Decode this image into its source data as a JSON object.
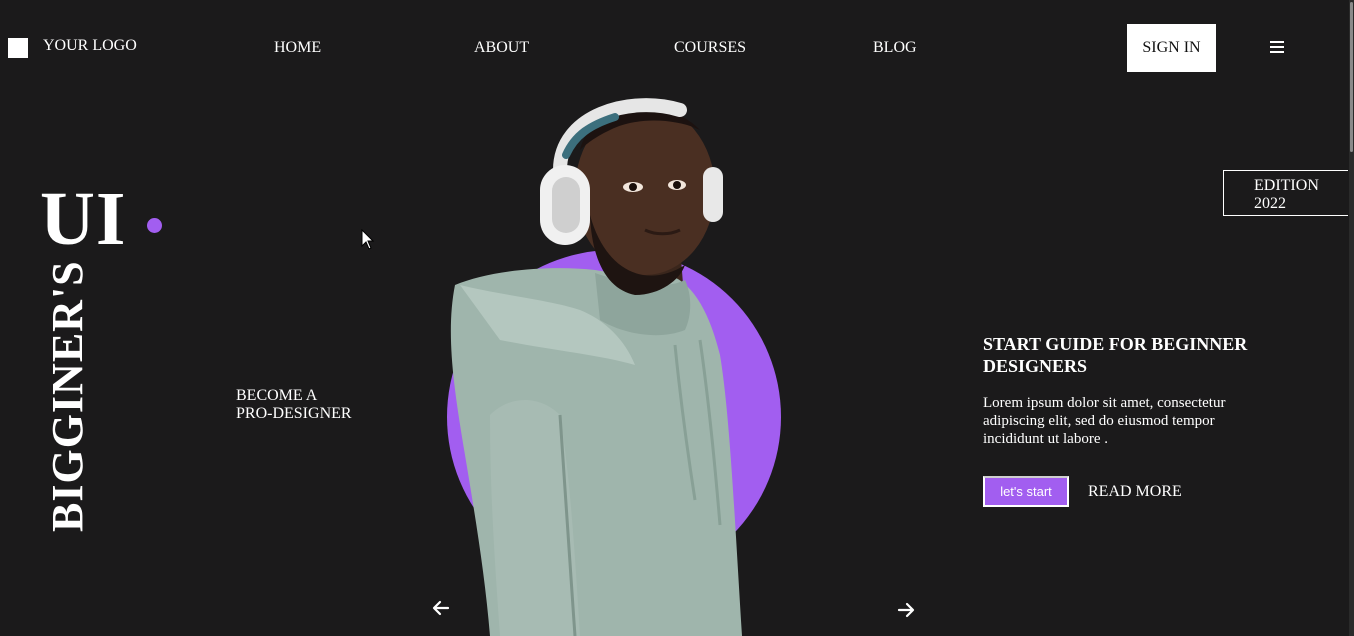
{
  "header": {
    "logo_text": "YOUR LOGO",
    "nav": [
      "HOME",
      "ABOUT",
      "COURSES",
      "BLOG"
    ],
    "signin_label": "SIGN IN",
    "menu_icon": "hamburger-icon"
  },
  "hero": {
    "big_title": "UI",
    "vertical_word": "BIGGINER'S",
    "tagline_line1": "BECOME A",
    "tagline_line2": "PRO-DESIGNER",
    "edition_line1": "EDITION",
    "edition_line2": "2022",
    "prev_icon": "arrow-left-icon",
    "next_icon": "arrow-right-icon"
  },
  "content": {
    "title_line1": "START GUIDE FOR BEGINNER",
    "title_line2": "DESIGNERS",
    "description": "Lorem ipsum dolor sit amet, consectetur adipiscing elit, sed do eiusmod tempor incididunt ut labore .",
    "primary_button": "let's start",
    "secondary_link": "READ MORE"
  },
  "colors": {
    "background": "#1b1a1b",
    "accent": "#a25ef0",
    "text": "#ffffff",
    "hoodie": "#9fb5ac"
  }
}
